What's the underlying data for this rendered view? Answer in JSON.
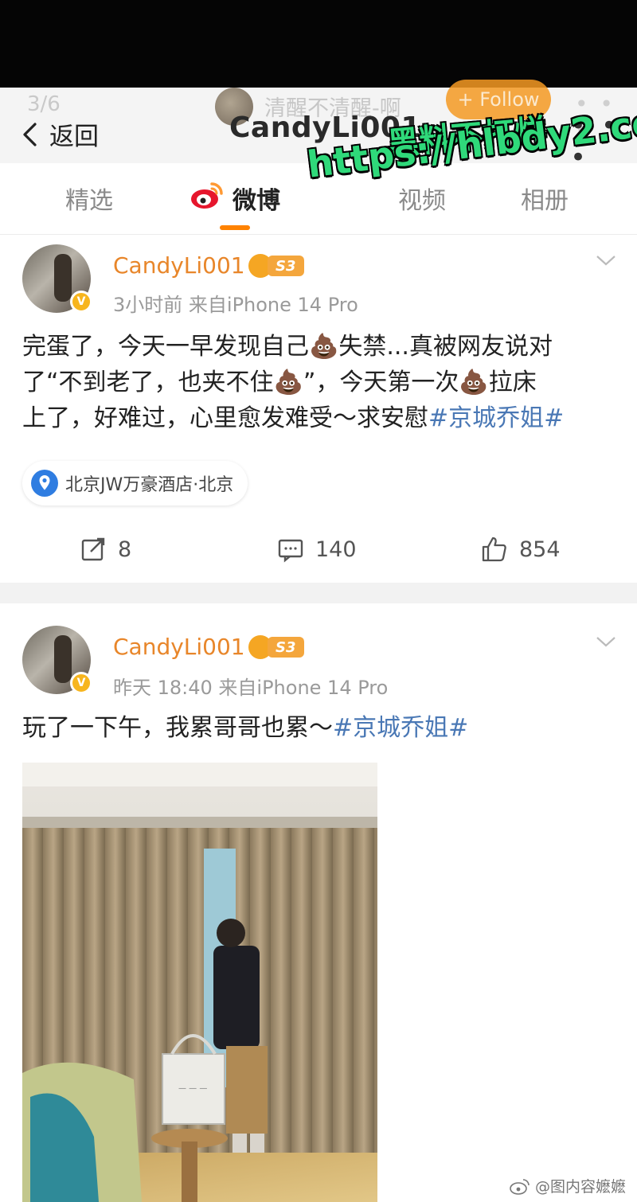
{
  "header": {
    "ghost_counter": "3/6",
    "back_label": "返回",
    "ghost_name": "清醒不清醒-啊",
    "title": "CandyLi001",
    "follow_label": "+ Follow",
    "more_label": "• • •"
  },
  "tabs": [
    {
      "label": "精选",
      "active": false
    },
    {
      "label": "微博",
      "active": true
    },
    {
      "label": "视频",
      "active": false
    },
    {
      "label": "相册",
      "active": false
    }
  ],
  "posts": [
    {
      "username": "CandyLi001",
      "level": "S3",
      "meta": "3小时前  来自iPhone 14 Pro",
      "text_line1": "完蛋了，今天一早发现自己💩失禁...真被网友说对",
      "text_line2": "了“不到老了，也夹不住💩”，今天第一次💩拉床",
      "text_line3_plain": "上了，好难过，心里愈发难受～求安慰",
      "hashtag": "#京城乔姐#",
      "location": "北京JW万豪酒店·北京",
      "reposts": "8",
      "comments": "140",
      "likes": "854"
    },
    {
      "username": "CandyLi001",
      "level": "S3",
      "meta": "昨天 18:40  来自iPhone 14 Pro",
      "text_plain": "玩了一下午，我累哥哥也累～",
      "hashtag": "#京城乔姐#"
    }
  ],
  "watermark": "@图内容嬷嬷",
  "promo": {
    "line1": "黑料不打烊",
    "line2": "https://hlbdy2.com"
  },
  "colors": {
    "accent_orange": "#ff8200",
    "username": "#e8862a",
    "hashtag": "#4a78b5",
    "promo_green": "#2fd97a"
  }
}
